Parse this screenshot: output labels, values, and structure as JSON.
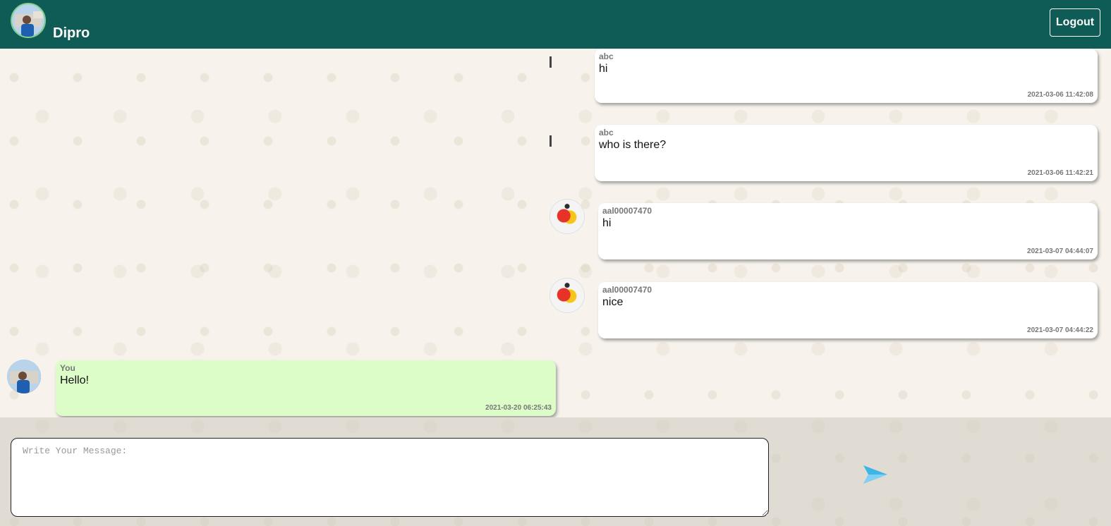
{
  "header": {
    "user_name": "Dipro",
    "logout_label": "Logout"
  },
  "messages": [
    {
      "sender": "abc",
      "text": "hi",
      "time": "2021-03-06 11:42:08"
    },
    {
      "sender": "abc",
      "text": "who is there?",
      "time": "2021-03-06 11:42:21"
    },
    {
      "sender": "aal00007470",
      "text": "hi",
      "time": "2021-03-07 04:44:07"
    },
    {
      "sender": "aal00007470",
      "text": "nice",
      "time": "2021-03-07 04:44:22"
    },
    {
      "sender": "You",
      "text": "Hello!",
      "time": "2021-03-20 06:25:43"
    }
  ],
  "composer": {
    "placeholder": "Write Your Message:",
    "value": ""
  },
  "colors": {
    "header_bg": "#0e5c55",
    "own_bubble": "#dcfcc8",
    "other_bubble": "#ffffff",
    "send_icon": "#3fb4e6"
  },
  "icons": {
    "send": "send-icon"
  }
}
